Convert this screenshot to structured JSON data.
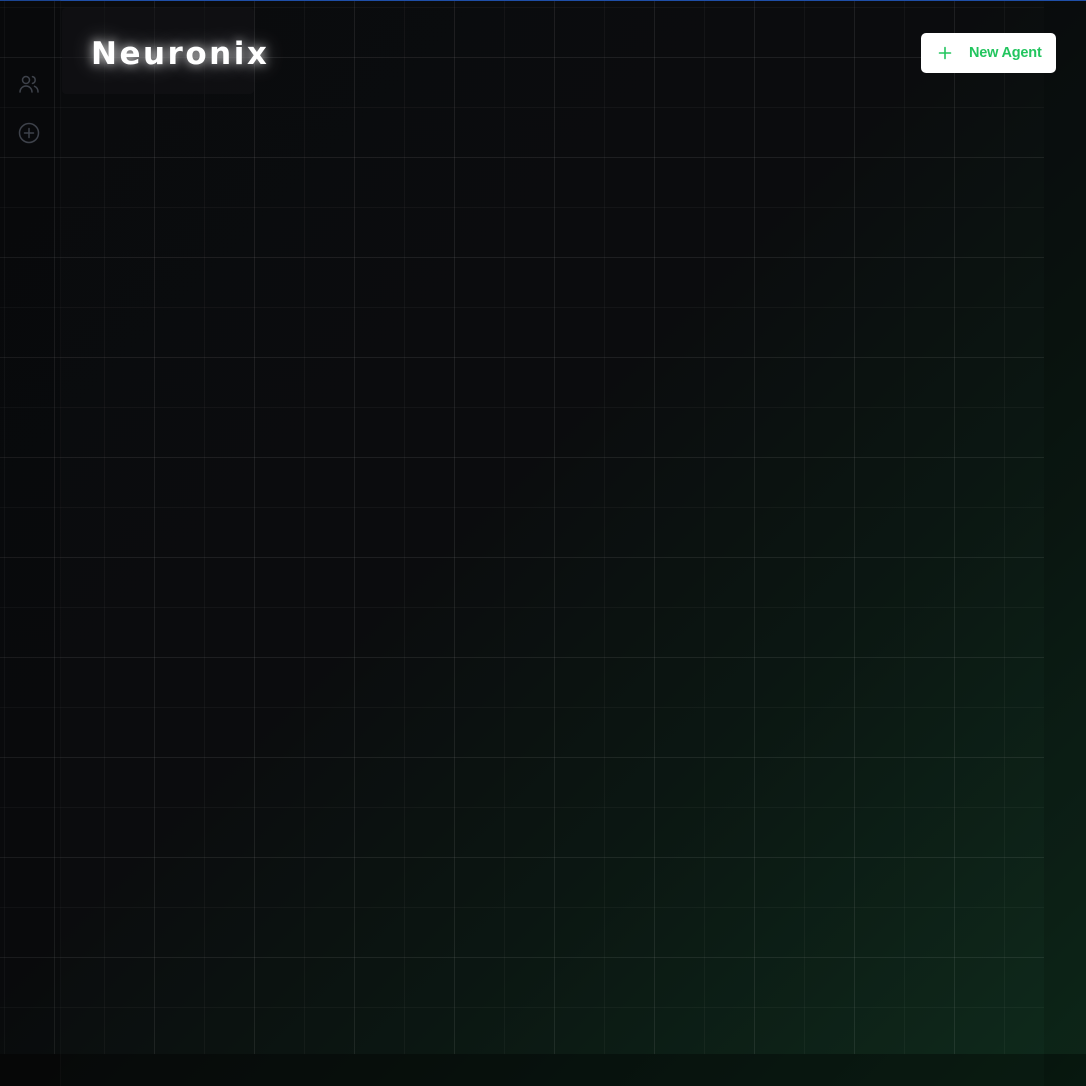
{
  "app": {
    "brand": "Neuronix"
  },
  "header": {
    "new_agent_label": "New Agent"
  },
  "sidebar": {
    "icons": [
      "users-icon",
      "add-circle-icon"
    ]
  },
  "colors": {
    "background": "#0b0c0e",
    "accent_green": "#22c55e",
    "top_accent": "#1f4fa8",
    "button_bg": "#ffffff"
  }
}
